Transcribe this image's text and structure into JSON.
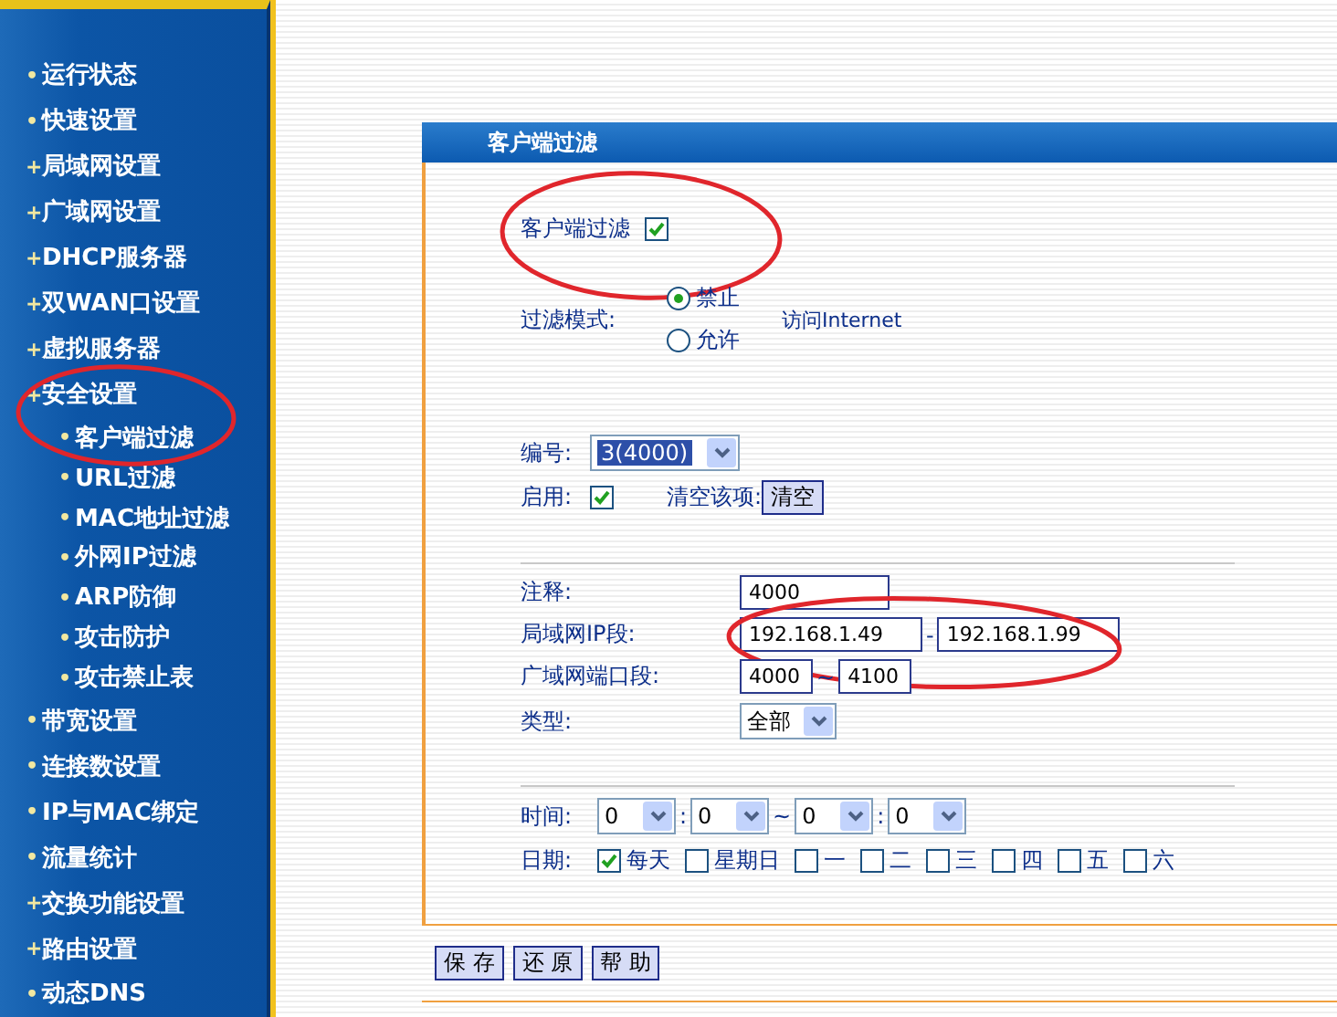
{
  "sidebar": {
    "items": [
      {
        "label": "运行状态",
        "marker": "•"
      },
      {
        "label": "快速设置",
        "marker": "•"
      },
      {
        "label": "局域网设置",
        "marker": "+"
      },
      {
        "label": "广域网设置",
        "marker": "+"
      },
      {
        "label": "DHCP服务器",
        "marker": "+"
      },
      {
        "label": "双WAN口设置",
        "marker": "+"
      },
      {
        "label": "虚拟服务器",
        "marker": "+"
      },
      {
        "label": "安全设置",
        "marker": "+",
        "expanded": true,
        "children": [
          {
            "label": "客户端过滤",
            "marker": "•",
            "circled": true
          },
          {
            "label": "URL过滤",
            "marker": "•"
          },
          {
            "label": "MAC地址过滤",
            "marker": "•"
          },
          {
            "label": "外网IP过滤",
            "marker": "•"
          },
          {
            "label": "ARP防御",
            "marker": "•"
          },
          {
            "label": "攻击防护",
            "marker": "•"
          },
          {
            "label": "攻击禁止表",
            "marker": "•"
          }
        ]
      },
      {
        "label": "带宽设置",
        "marker": "•"
      },
      {
        "label": "连接数设置",
        "marker": "•"
      },
      {
        "label": "IP与MAC绑定",
        "marker": "•"
      },
      {
        "label": "流量统计",
        "marker": "•"
      },
      {
        "label": "交换功能设置",
        "marker": "+"
      },
      {
        "label": "路由设置",
        "marker": "+"
      },
      {
        "label": "动态DNS",
        "marker": "•"
      }
    ]
  },
  "panel": {
    "title": "客户端过滤"
  },
  "filter_enable": {
    "label": "客户端过滤",
    "checked": true,
    "circled": true
  },
  "filter_mode": {
    "label": "过滤模式:",
    "options": [
      {
        "label": "禁止",
        "selected": true
      },
      {
        "label": "允许",
        "selected": false
      }
    ],
    "suffix": "访问Internet"
  },
  "number": {
    "label": "编号:",
    "value": "3(4000)"
  },
  "enable": {
    "label": "启用:",
    "checked": true,
    "clear_label": "清空该项:",
    "clear_button": "清空"
  },
  "fields": [
    {
      "kind": "text",
      "label": "注释:",
      "value": "4000"
    },
    {
      "kind": "range",
      "label": "局域网IP段:",
      "from": "192.168.1.49",
      "separator": "-",
      "to": "192.168.1.99",
      "circled": true
    },
    {
      "kind": "short_range",
      "label": "广域网端口段:",
      "from": "4000",
      "separator": "~",
      "to": "4100"
    },
    {
      "kind": "select",
      "label": "类型:",
      "value": "全部"
    }
  ],
  "time": {
    "label": "时间:",
    "selects": [
      "0",
      "0",
      "0",
      "0"
    ],
    "separators": [
      ":",
      "~",
      ":"
    ]
  },
  "date": {
    "label": "日期:",
    "days": [
      {
        "label": "每天",
        "checked": true
      },
      {
        "label": "星期日",
        "checked": false
      },
      {
        "label": "一",
        "checked": false
      },
      {
        "label": "二",
        "checked": false
      },
      {
        "label": "三",
        "checked": false
      },
      {
        "label": "四",
        "checked": false
      },
      {
        "label": "五",
        "checked": false
      },
      {
        "label": "六",
        "checked": false
      }
    ]
  },
  "buttons": [
    "保 存",
    "还 原",
    "帮 助"
  ]
}
